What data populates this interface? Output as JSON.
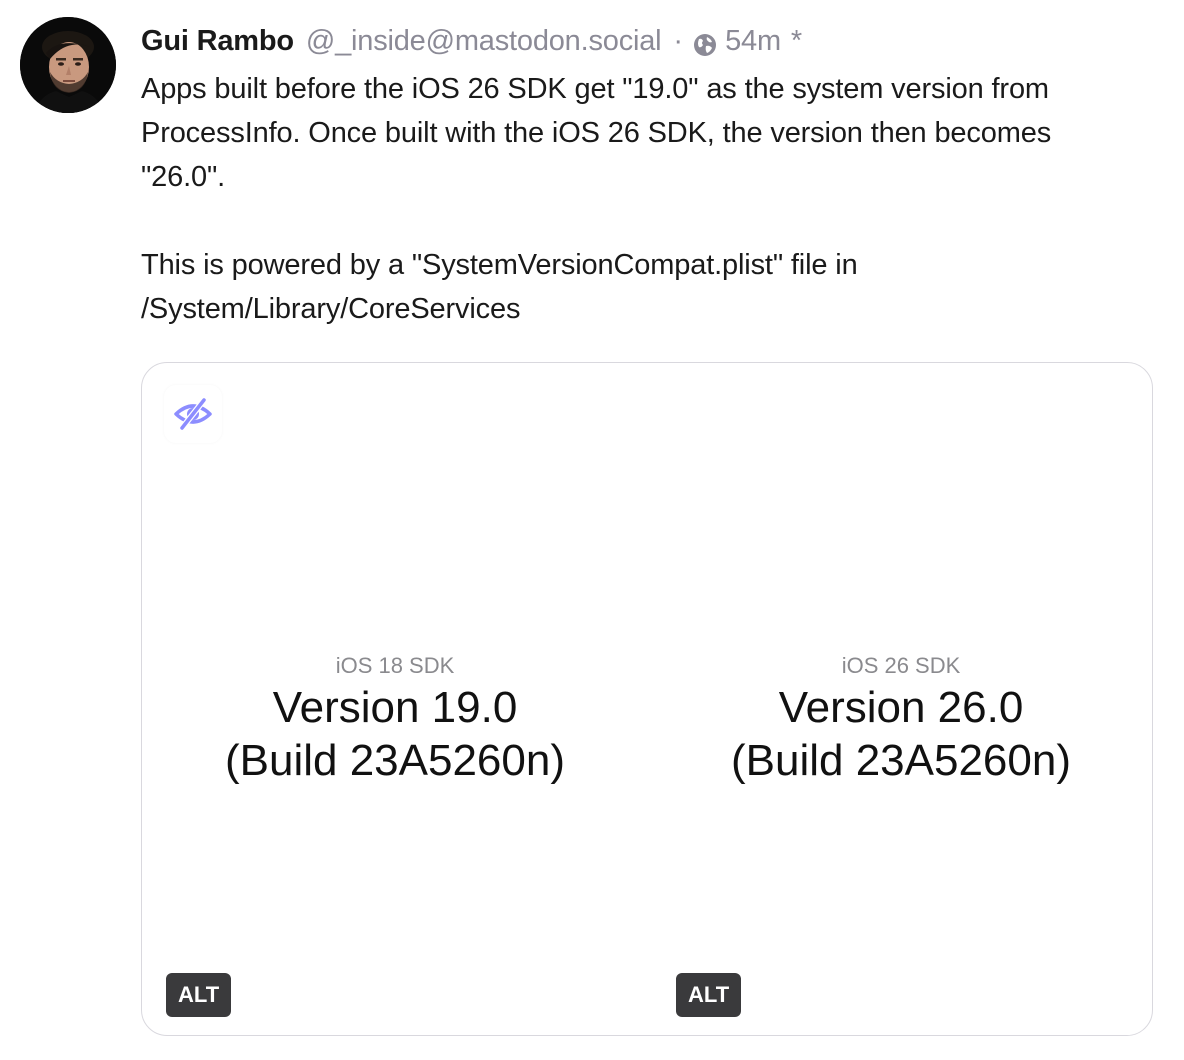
{
  "author": {
    "display_name": "Gui Rambo",
    "handle": "@_inside@mastodon.social",
    "separator": "·",
    "visibility_icon": "globe-icon",
    "time_ago": "54m",
    "edited_marker": "*"
  },
  "post": {
    "paragraphs": [
      "Apps built before the iOS 26 SDK get \"19.0\" as the system version from\nProcessInfo. Once built with the iOS 26 SDK, the version then becomes\n\"26.0\".",
      "This is powered by a \"SystemVersionCompat.plist\" file in\n/System/Library/CoreServices"
    ]
  },
  "media": {
    "sensitive_toggle_icon": "eye-slash-icon",
    "images": [
      {
        "sdk_label": "iOS 18 SDK",
        "version_line": "Version 19.0",
        "build_line": "(Build 23A5260n)",
        "alt_label": "ALT"
      },
      {
        "sdk_label": "iOS 26 SDK",
        "version_line": "Version 26.0",
        "build_line": "(Build 23A5260n)",
        "alt_label": "ALT"
      }
    ]
  },
  "colors": {
    "muted_text": "#8b8a96",
    "accent_icon": "#8c8dff",
    "alt_badge_bg": "#3a3a3c"
  }
}
